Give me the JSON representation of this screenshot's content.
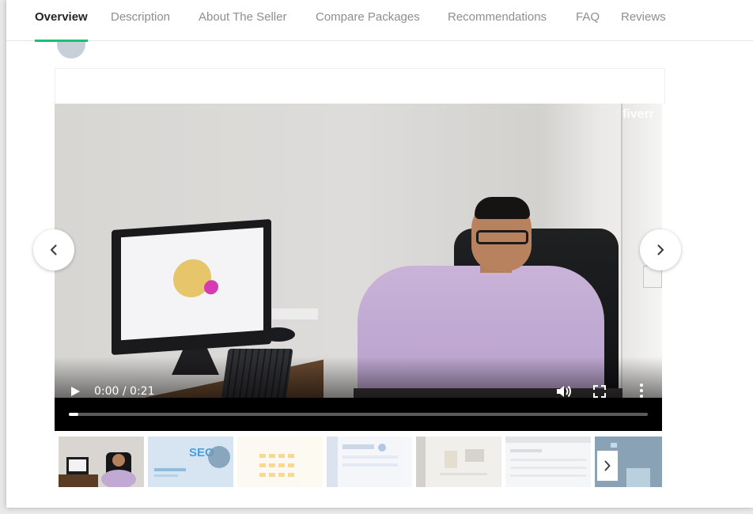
{
  "tabs": [
    {
      "label": "Overview",
      "active": true
    },
    {
      "label": "Description",
      "active": false
    },
    {
      "label": "About The Seller",
      "active": false
    },
    {
      "label": "Compare Packages",
      "active": false
    },
    {
      "label": "Recommendations",
      "active": false
    },
    {
      "label": "FAQ",
      "active": false
    },
    {
      "label": "Reviews",
      "active": false
    }
  ],
  "video": {
    "watermark": "fiverr",
    "time": "0:00 / 0:21",
    "progress_fraction": 0.0
  },
  "thumbnails": {
    "seo_label": "SEO"
  },
  "colors": {
    "accent": "#1dbf73",
    "tab_inactive": "#8c8e94",
    "tab_active": "#222325"
  },
  "icons": {
    "prev": "chevron-left-icon",
    "next": "chevron-right-icon",
    "play": "play-icon",
    "volume": "volume-icon",
    "fullscreen": "fullscreen-icon",
    "more": "more-vertical-icon"
  }
}
